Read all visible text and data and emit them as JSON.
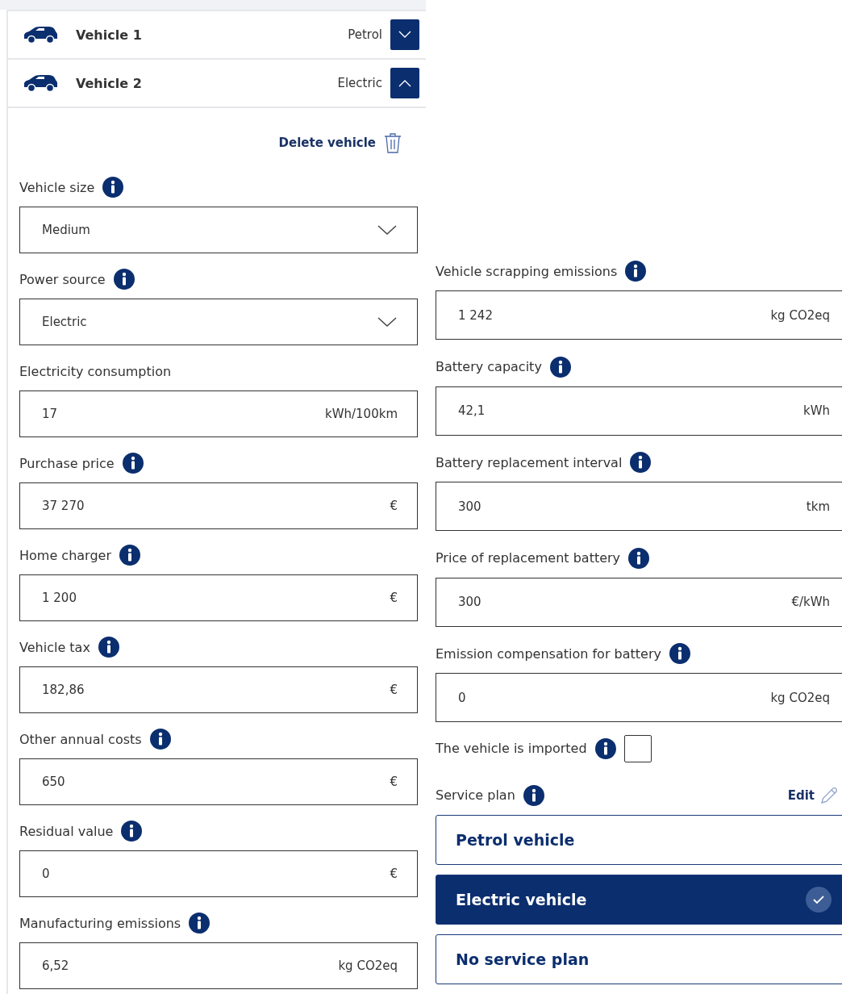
{
  "vehicles": [
    {
      "name": "Vehicle 1",
      "fuel": "Petrol",
      "expanded": false
    },
    {
      "name": "Vehicle 2",
      "fuel": "Electric",
      "expanded": true
    }
  ],
  "delete_label": "Delete vehicle",
  "left_fields": [
    {
      "label": "Vehicle size",
      "info": true,
      "kind": "select",
      "value": "Medium"
    },
    {
      "label": "Power source",
      "info": true,
      "kind": "select",
      "value": "Electric"
    },
    {
      "label": "Electricity consumption",
      "info": false,
      "kind": "input",
      "value": "17",
      "unit": "kWh/100km"
    },
    {
      "label": "Purchase price",
      "info": true,
      "kind": "input",
      "value": "37 270",
      "unit": "€"
    },
    {
      "label": "Home charger",
      "info": true,
      "kind": "input",
      "value": "1 200",
      "unit": "€"
    },
    {
      "label": "Vehicle tax",
      "info": true,
      "kind": "input",
      "value": "182,86",
      "unit": "€"
    },
    {
      "label": "Other annual costs",
      "info": true,
      "kind": "input",
      "value": "650",
      "unit": "€"
    },
    {
      "label": "Residual value",
      "info": true,
      "kind": "input",
      "value": "0",
      "unit": "€"
    },
    {
      "label": "Manufacturing emissions",
      "info": true,
      "kind": "input",
      "value": "6,52",
      "unit": "kg CO2eq"
    }
  ],
  "right_fields": [
    {
      "label": "Vehicle scrapping emissions",
      "info": true,
      "kind": "input",
      "value": "1 242",
      "unit": "kg CO2eq"
    },
    {
      "label": "Battery capacity",
      "info": true,
      "kind": "input",
      "value": "42,1",
      "unit": "kWh"
    },
    {
      "label": "Battery replacement interval",
      "info": true,
      "kind": "input",
      "value": "300",
      "unit": "tkm"
    },
    {
      "label": "Price of replacement battery",
      "info": true,
      "kind": "input",
      "value": "300",
      "unit": "€/kWh"
    },
    {
      "label": "Emission compensation for battery",
      "info": true,
      "kind": "input",
      "value": "0",
      "unit": "kg CO2eq"
    }
  ],
  "imported": {
    "label": "The vehicle is imported",
    "checked": false
  },
  "service_plan": {
    "label": "Service plan",
    "edit_label": "Edit",
    "options": [
      {
        "label": "Petrol vehicle",
        "selected": false
      },
      {
        "label": "Electric vehicle",
        "selected": true
      },
      {
        "label": "No service plan",
        "selected": false
      }
    ]
  }
}
